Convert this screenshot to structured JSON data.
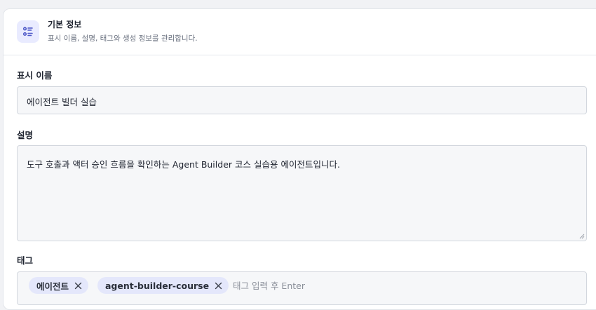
{
  "section": {
    "icon": "list-settings-icon",
    "title": "기본 정보",
    "subtitle": "표시 이름, 설명, 태그와 생성 정보를 관리합니다."
  },
  "display_name": {
    "label": "표시 이름",
    "value": "에이전트 빌더 실습"
  },
  "description": {
    "label": "설명",
    "value": "도구 호출과 액터 승인 흐름을 확인하는 Agent Builder 코스 실습용 에이전트입니다."
  },
  "tags": {
    "label": "태그",
    "items": [
      {
        "label": "에이전트"
      },
      {
        "label": "agent-builder-course"
      }
    ],
    "input_placeholder": "태그 입력 후 Enter"
  },
  "colors": {
    "accent_bg": "#e9ebff",
    "accent_icon": "#4a55c7",
    "tag_bg": "#e4e7fb",
    "field_bg": "#f6f7f9"
  }
}
